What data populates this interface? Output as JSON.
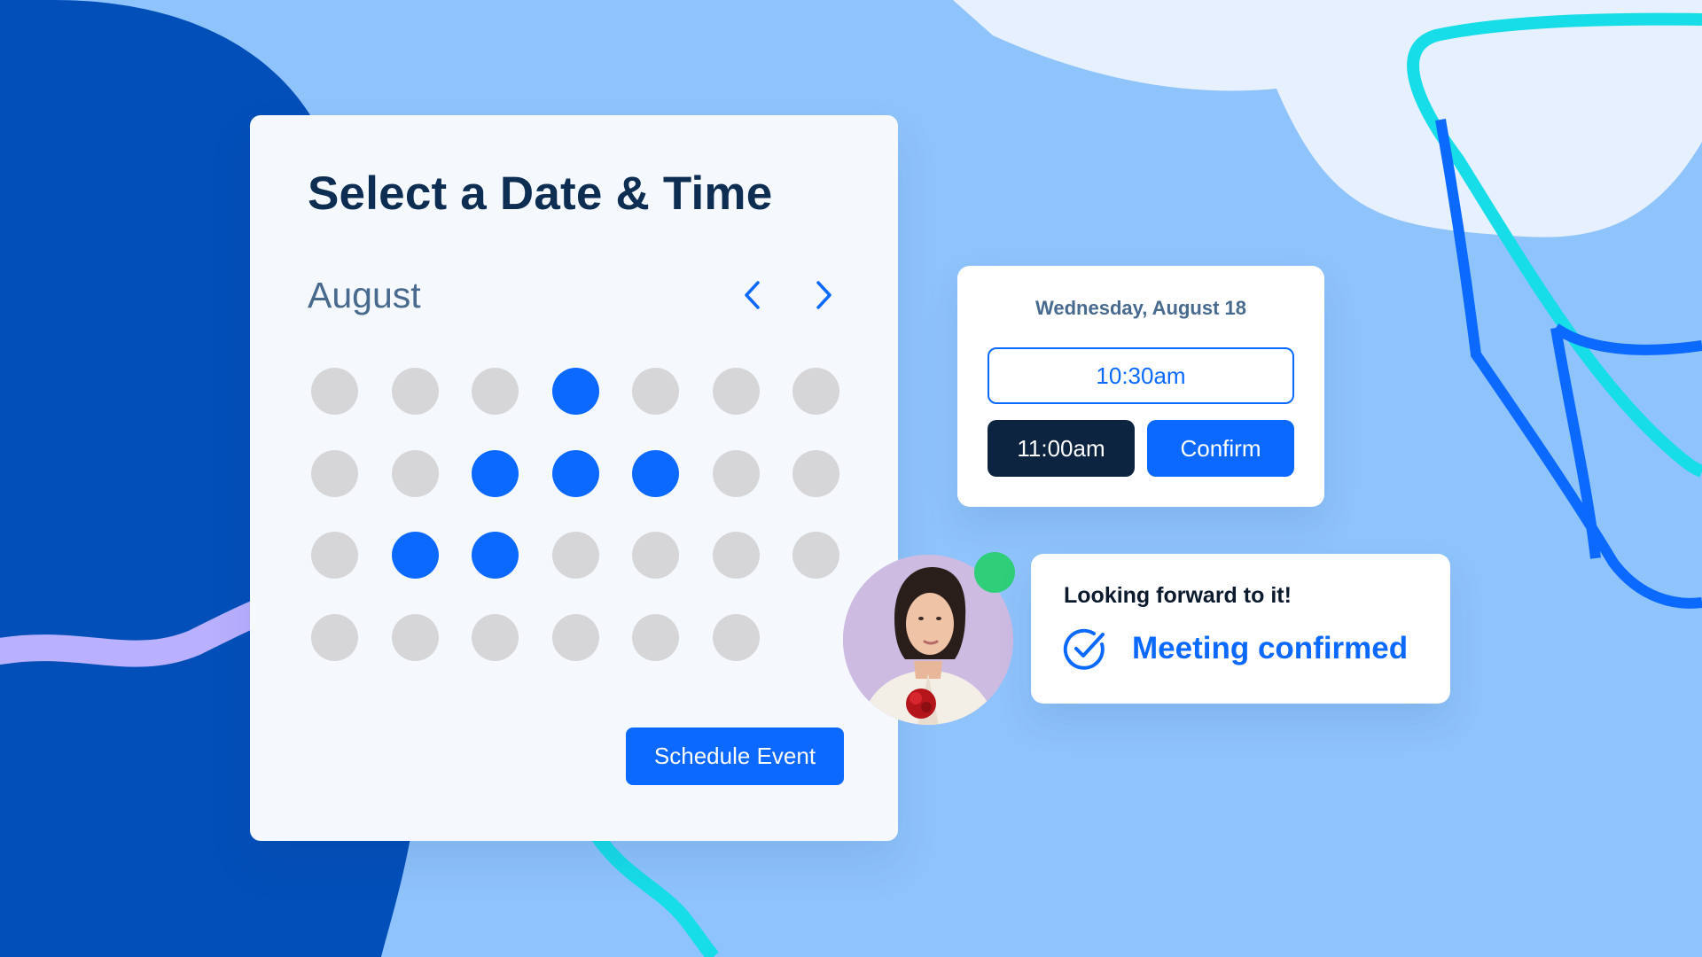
{
  "calendar": {
    "title": "Select a Date & Time",
    "month": "August",
    "nav": {
      "prev_icon": "chevron-left-icon",
      "next_icon": "chevron-right-icon"
    },
    "days": [
      [
        false,
        false,
        false,
        true,
        false,
        false,
        false
      ],
      [
        false,
        false,
        true,
        true,
        true,
        false,
        false
      ],
      [
        false,
        true,
        true,
        false,
        false,
        false,
        false
      ],
      [
        false,
        false,
        false,
        false,
        false,
        false
      ]
    ],
    "schedule_button": "Schedule Event"
  },
  "time_picker": {
    "date": "Wednesday, August 18",
    "slot_option": "10:30am",
    "selected_slot": "11:00am",
    "confirm_button": "Confirm"
  },
  "confirmation": {
    "message": "Looking forward to it!",
    "status": "Meeting confirmed",
    "status_icon": "check-circle-icon"
  },
  "avatar": {
    "online": true
  },
  "colors": {
    "background": "#8fc3fb",
    "accent": "#0b69ff",
    "dark": "#0d2440",
    "available_day": "#0b69ff",
    "unavailable_day": "#d6d6d8",
    "online": "#2ecf78"
  }
}
